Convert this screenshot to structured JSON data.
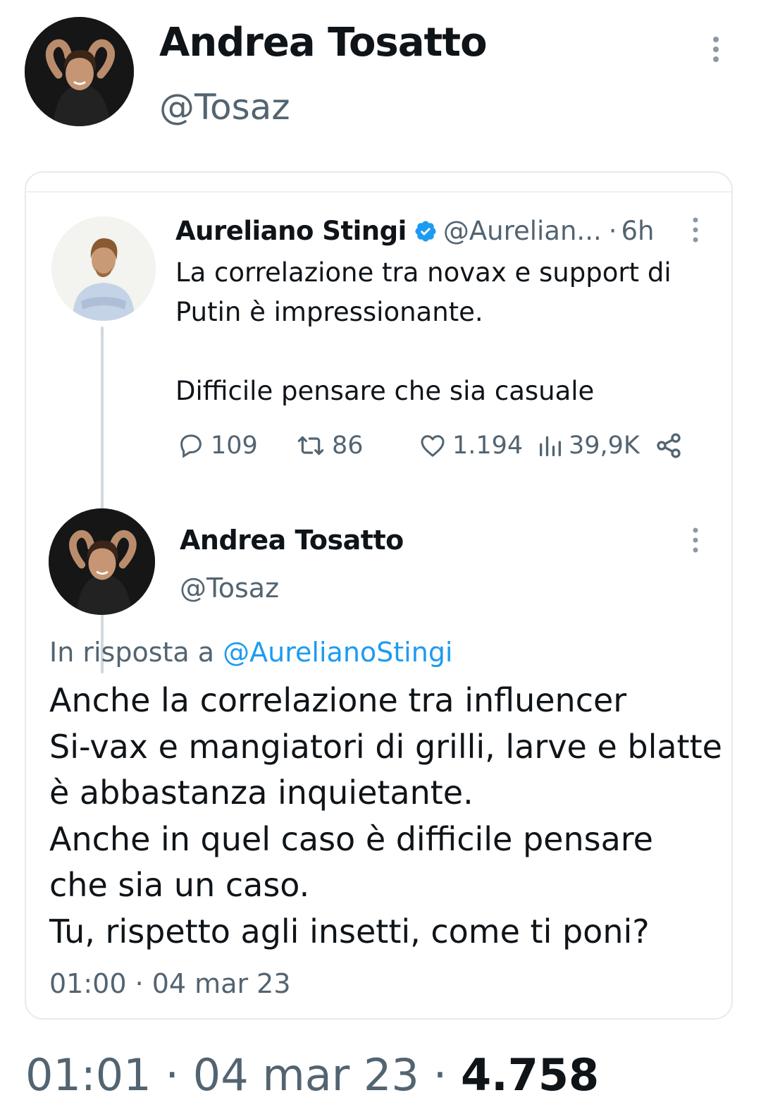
{
  "header": {
    "name": "Andrea Tosatto",
    "handle": "@Tosaz"
  },
  "quoted_tweet": {
    "name": "Aureliano Stingi",
    "handle": "@Aurelian...",
    "separator": "·",
    "time": "6h",
    "text_lines": [
      "La correlazione tra novax e support di",
      "Putin è impressionante.",
      "",
      "Difficile pensare che sia casuale"
    ],
    "stats": {
      "replies": "109",
      "retweets": "86",
      "likes": "1.194",
      "views": "39,9K"
    }
  },
  "reply_tweet": {
    "name": "Andrea Tosatto",
    "handle": "@Tosaz",
    "reply_prefix": "In risposta a",
    "reply_mention": "@AurelianoStingi",
    "text_lines": [
      "Anche la correlazione tra influencer",
      "Si-vax e mangiatori di grilli, larve e blatte",
      "è abbastanza inquietante.",
      "Anche in quel caso è difficile pensare",
      "che sia un caso.",
      "Tu, rispetto agli insetti, come ti poni?"
    ],
    "timestamp": "01:00 · 04 mar 23"
  },
  "footer": {
    "timestamp": "01:01 · 04 mar 23 ·",
    "views": "4.758"
  },
  "icons": [
    "more-vertical-icon",
    "verified-badge-icon",
    "reply-icon",
    "retweet-icon",
    "like-icon",
    "views-icon",
    "share-icon"
  ],
  "colors": {
    "text": "#0f1419",
    "secondary": "#536471",
    "accent": "#1d9bf0",
    "border": "#e7eaed"
  }
}
